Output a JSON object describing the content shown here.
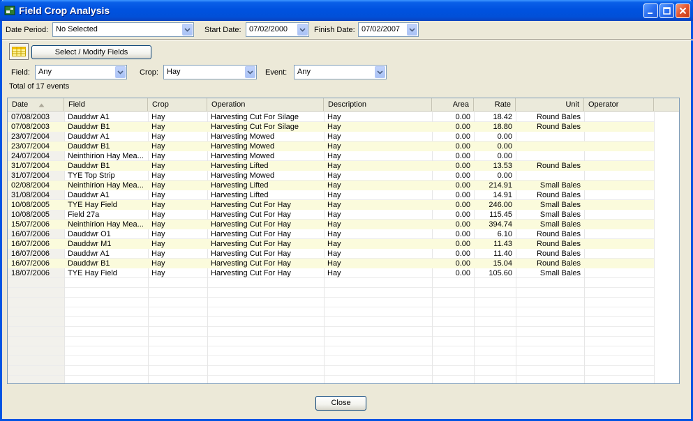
{
  "window": {
    "title": "Field Crop Analysis"
  },
  "filters_top": {
    "date_period_label": "Date Period:",
    "date_period_value": "No Selected",
    "start_date_label": "Start Date:",
    "start_date_value": "07/02/2000",
    "finish_date_label": "Finish Date:",
    "finish_date_value": "07/02/2007"
  },
  "toolbar": {
    "select_fields_label": "Select / Modify Fields"
  },
  "filters": {
    "field_label": "Field:",
    "field_value": "Any",
    "crop_label": "Crop:",
    "crop_value": "Hay",
    "event_label": "Event:",
    "event_value": "Any",
    "total_text": "Total of 17 events"
  },
  "table": {
    "columns": [
      "Date",
      "Field",
      "Crop",
      "Operation",
      "Description",
      "Area",
      "Rate",
      "Unit",
      "Operator"
    ],
    "sort_column": "Date",
    "rows": [
      [
        "07/08/2003",
        "Dauddwr A1",
        "Hay",
        "Harvesting Cut For Silage",
        "Hay",
        "0.00",
        "18.42",
        "Round Bales",
        ""
      ],
      [
        "07/08/2003",
        "Dauddwr B1",
        "Hay",
        "Harvesting Cut For Silage",
        "Hay",
        "0.00",
        "18.80",
        "Round Bales",
        ""
      ],
      [
        "23/07/2004",
        "Dauddwr A1",
        "Hay",
        "Harvesting Mowed",
        "Hay",
        "0.00",
        "0.00",
        "",
        ""
      ],
      [
        "23/07/2004",
        "Dauddwr B1",
        "Hay",
        "Harvesting Mowed",
        "Hay",
        "0.00",
        "0.00",
        "",
        ""
      ],
      [
        "24/07/2004",
        "Neinthirion Hay Mea...",
        "Hay",
        "Harvesting Mowed",
        "Hay",
        "0.00",
        "0.00",
        "",
        ""
      ],
      [
        "31/07/2004",
        "Dauddwr B1",
        "Hay",
        "Harvesting Lifted",
        "Hay",
        "0.00",
        "13.53",
        "Round Bales",
        ""
      ],
      [
        "31/07/2004",
        "TYE Top Strip",
        "Hay",
        "Harvesting Mowed",
        "Hay",
        "0.00",
        "0.00",
        "",
        ""
      ],
      [
        "02/08/2004",
        "Neinthirion Hay Mea...",
        "Hay",
        "Harvesting Lifted",
        "Hay",
        "0.00",
        "214.91",
        "Small Bales",
        ""
      ],
      [
        "31/08/2004",
        "Dauddwr A1",
        "Hay",
        "Harvesting Lifted",
        "Hay",
        "0.00",
        "14.91",
        "Round Bales",
        ""
      ],
      [
        "10/08/2005",
        "TYE Hay Field",
        "Hay",
        "Harvesting Cut For Hay",
        "Hay",
        "0.00",
        "246.00",
        "Small Bales",
        ""
      ],
      [
        "10/08/2005",
        "Field 27a",
        "Hay",
        "Harvesting Cut For Hay",
        "Hay",
        "0.00",
        "115.45",
        "Small Bales",
        ""
      ],
      [
        "15/07/2006",
        "Neinthirion Hay Mea...",
        "Hay",
        "Harvesting Cut For Hay",
        "Hay",
        "0.00",
        "394.74",
        "Small Bales",
        ""
      ],
      [
        "16/07/2006",
        "Dauddwr O1",
        "Hay",
        "Harvesting Cut For Hay",
        "Hay",
        "0.00",
        "6.10",
        "Round Bales",
        ""
      ],
      [
        "16/07/2006",
        "Dauddwr M1",
        "Hay",
        "Harvesting Cut For Hay",
        "Hay",
        "0.00",
        "11.43",
        "Round Bales",
        ""
      ],
      [
        "16/07/2006",
        "Dauddwr A1",
        "Hay",
        "Harvesting Cut For Hay",
        "Hay",
        "0.00",
        "11.40",
        "Round Bales",
        ""
      ],
      [
        "16/07/2006",
        "Dauddwr B1",
        "Hay",
        "Harvesting Cut For Hay",
        "Hay",
        "0.00",
        "15.04",
        "Round Bales",
        ""
      ],
      [
        "18/07/2006",
        "TYE Hay Field",
        "Hay",
        "Harvesting Cut For Hay",
        "Hay",
        "0.00",
        "105.60",
        "Small Bales",
        ""
      ]
    ]
  },
  "footer": {
    "close_label": "Close"
  },
  "colors": {
    "title_bar": "#0052e0",
    "row_highlight": "#fbfbdc",
    "window_bg": "#ece9d8"
  }
}
